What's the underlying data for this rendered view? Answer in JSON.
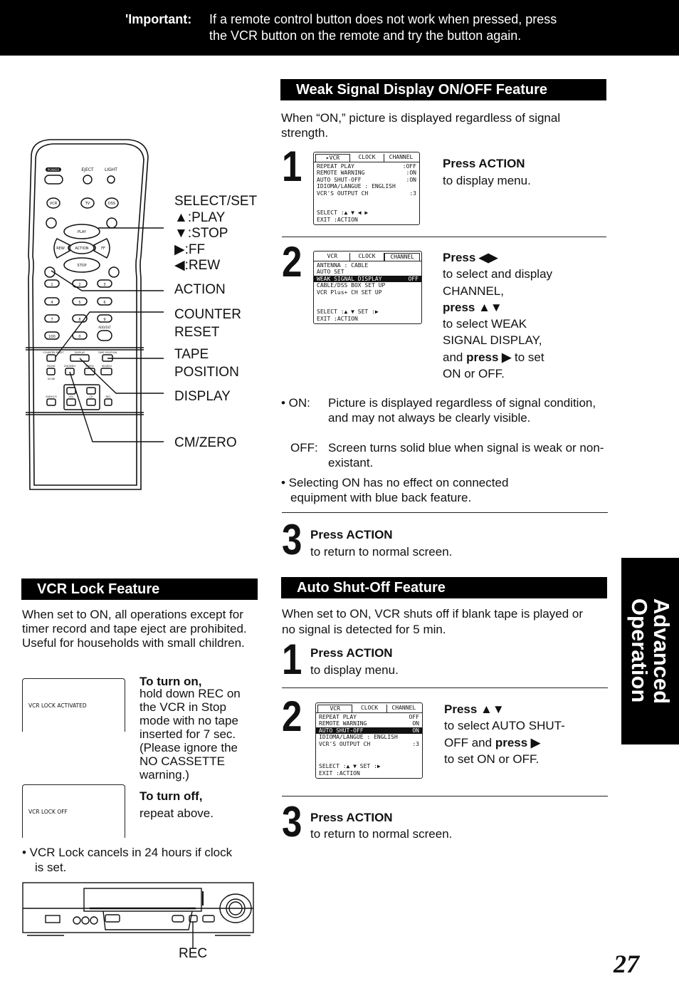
{
  "banner": {
    "label": "'Important:",
    "line1": "If a remote control button does not work when pressed, press",
    "line2": "the VCR button on the remote and try the button again."
  },
  "remote": {
    "labels": {
      "select_set": "SELECT/SET",
      "play": ":PLAY",
      "stop": ":STOP",
      "ff": ":FF",
      "rew": ":REW",
      "action": "ACTION",
      "counter": "COUNTER",
      "reset": "RESET",
      "tape": "TAPE",
      "position": "POSITION",
      "display": "DISPLAY",
      "cm_zero": "CM/ZERO"
    },
    "button_texts": {
      "power": "POWER",
      "eject": "EJECT",
      "light": "LIGHT",
      "vcr": "VCR",
      "tv": "TV",
      "dss": "DSS CABLE",
      "play": "PLAY",
      "stop": "STOP",
      "rew": "REW",
      "ff": "FF",
      "center": "ACTION",
      "n1": "1",
      "n2": "2",
      "n3": "3",
      "n4": "4",
      "n5": "5",
      "n6": "6",
      "n7": "7",
      "n8": "8",
      "n9": "9",
      "n100": "100",
      "n0": "0",
      "add_dlt": "ADD/DLT",
      "counter_reset": "COUNTER RESET",
      "display": "DISPLAY",
      "tape_position": "TAPE POSITION",
      "pause": "PAUSE",
      "cm_zero": "CM/ZERO",
      "speed": "SPEED",
      "search": "SEARCH",
      "slow": "SLOW",
      "sap": "SAP/Hi-Fi",
      "vol": "VOL",
      "ch": "CH",
      "rec": "REC"
    }
  },
  "weak_signal": {
    "title": "Weak Signal Display ON/OFF Feature",
    "intro": "When “ON,” picture is displayed regardless of signal strength.",
    "step1": {
      "num": "1",
      "title": "Press ACTION",
      "desc": "to display menu.",
      "osd": {
        "tabs": [
          "▸VCR",
          "CLOCK",
          "CHANNEL"
        ],
        "rows": [
          [
            "REPEAT PLAY",
            ":OFF"
          ],
          [
            "REMOTE WARNING",
            ":ON"
          ],
          [
            "AUTO SHUT-OFF",
            ":ON"
          ],
          [
            "IDIOMA/LANGUE : ENGLISH",
            ""
          ],
          [
            "VCR'S OUTPUT CH",
            ":3"
          ]
        ],
        "footer1": "SELECT :▲ ▼ ◀ ▶",
        "footer2": "EXIT    :ACTION"
      }
    },
    "step2": {
      "num": "2",
      "l1": "Press ◀▶",
      "l2": "to select and display",
      "l3": "CHANNEL,",
      "l4": "press ▲▼",
      "l5": "to select WEAK",
      "l6": "SIGNAL DISPLAY,",
      "l7a": "and ",
      "l7b": "press ▶",
      "l7c": " to set",
      "l8": "ON or OFF.",
      "osd": {
        "tabs": [
          "VCR",
          "CLOCK",
          "CHANNEL"
        ],
        "rows": [
          [
            "ANTENNA : CABLE",
            ""
          ],
          [
            "AUTO SET",
            ""
          ],
          [
            "WEAK SIGNAL DISPLAY",
            "OFF"
          ],
          [
            "CABLE/DSS BOX SET UP",
            ""
          ],
          [
            "VCR Plus+ CH SET UP",
            ""
          ]
        ],
        "footer1": "SELECT :▲ ▼     SET :▶",
        "footer2": "EXIT    :ACTION"
      }
    },
    "notes": {
      "on_label": "• ON:",
      "on_text": "Picture is displayed regardless of signal condition, and may not always be clearly visible.",
      "off_label": "OFF:",
      "off_text": "Screen turns solid blue when signal is weak or  non-existant.",
      "note2": "• Selecting ON has no effect on connected equipment with blue back feature."
    },
    "step3": {
      "num": "3",
      "title": "Press ACTION",
      "desc": "to return to normal screen."
    }
  },
  "vcr_lock": {
    "title": "VCR Lock Feature",
    "intro": "When set to ON, all operations except for timer record and tape eject are prohibited. Useful for households with small children.",
    "screen_on": "VCR LOCK ACTIVATED",
    "screen_off": "VCR LOCK OFF",
    "turn_on_title": "To turn on,",
    "turn_on_text": "hold down REC on the VCR in Stop mode with no tape inserted for 7 sec. (Please ignore the NO CASSETTE warning.)",
    "turn_off_title": "To turn off,",
    "turn_off_text": "repeat above.",
    "note": "•  VCR Lock cancels in 24 hours if clock is set.",
    "rec_label": "REC"
  },
  "auto_shutoff": {
    "title": "Auto Shut-Off Feature",
    "intro": "When set to ON, VCR shuts off if blank tape is played or no signal is detected for 5 min.",
    "step1": {
      "num": "1",
      "title": "Press ACTION",
      "desc": "to display menu."
    },
    "step2": {
      "num": "2",
      "l1": "Press ▲▼",
      "l2": "to select AUTO SHUT-",
      "l3a": "OFF and ",
      "l3b": "press ▶",
      "l4": "to set ON or OFF.",
      "osd": {
        "tabs": [
          "VCR",
          "CLOCK",
          "CHANNEL"
        ],
        "rows": [
          [
            "REPEAT PLAY",
            "OFF"
          ],
          [
            "REMOTE WARNING",
            "ON"
          ],
          [
            "AUTO SHUT-OFF",
            "ON"
          ],
          [
            "IDIOMA/LANGUE : ENGLISH",
            ""
          ],
          [
            "VCR'S OUTPUT CH",
            ":3"
          ]
        ],
        "footer1": "SELECT :▲ ▼     SET :▶",
        "footer2": "EXIT    :ACTION"
      }
    },
    "step3": {
      "num": "3",
      "title": "Press ACTION",
      "desc": "to return to normal screen."
    }
  },
  "side_tab": {
    "line1": "Advanced",
    "line2": "Operation"
  },
  "page_number": "27"
}
